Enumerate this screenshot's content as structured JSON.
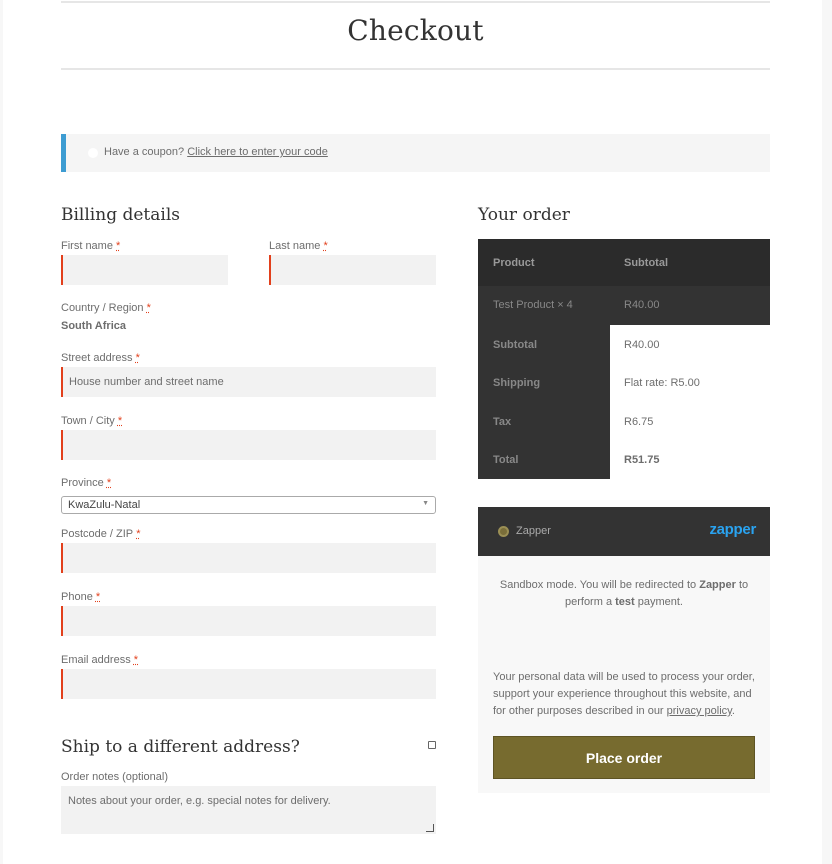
{
  "page": {
    "title": "Checkout"
  },
  "coupon": {
    "text": "Have a coupon?",
    "link": "Click here to enter your code"
  },
  "billing": {
    "heading": "Billing details",
    "first_name_label": "First name",
    "last_name_label": "Last name",
    "country_label": "Country / Region",
    "country_value": "South Africa",
    "street_label": "Street address",
    "street_placeholder": "House number and street name",
    "town_label": "Town / City",
    "province_label": "Province",
    "province_value": "KwaZulu-Natal",
    "postcode_label": "Postcode / ZIP",
    "phone_label": "Phone",
    "email_label": "Email address",
    "required_mark": "*"
  },
  "shipping": {
    "heading": "Ship to a different address?",
    "notes_label": "Order notes (optional)",
    "notes_placeholder": "Notes about your order, e.g. special notes for delivery."
  },
  "order": {
    "heading": "Your order",
    "col_product": "Product",
    "col_subtotal": "Subtotal",
    "item_name": "Test Product  × 4",
    "item_total": "R40.00",
    "subtotal_label": "Subtotal",
    "subtotal_value": "R40.00",
    "shipping_label": "Shipping",
    "shipping_value": "Flat rate: R5.00",
    "tax_label": "Tax",
    "tax_value": "R6.75",
    "total_label": "Total",
    "total_value": "R51.75"
  },
  "payment": {
    "method_label": "Zapper",
    "logo_text": "zapper",
    "sandbox_pre": "Sandbox mode. You will be redirected to ",
    "sandbox_brand": "Zapper",
    "sandbox_mid": " to perform a ",
    "sandbox_test": "test",
    "sandbox_post": " payment.",
    "privacy_text": "Your personal data will be used to process your order, support your experience throughout this website, and for other purposes described in our ",
    "privacy_link": "privacy policy",
    "privacy_end": ".",
    "place_order": "Place order"
  },
  "colors": {
    "accent": "#776b2f",
    "required": "#e2401c",
    "coupon_bar": "#3d9cd2",
    "zapper_blue": "#2aa3f0"
  }
}
